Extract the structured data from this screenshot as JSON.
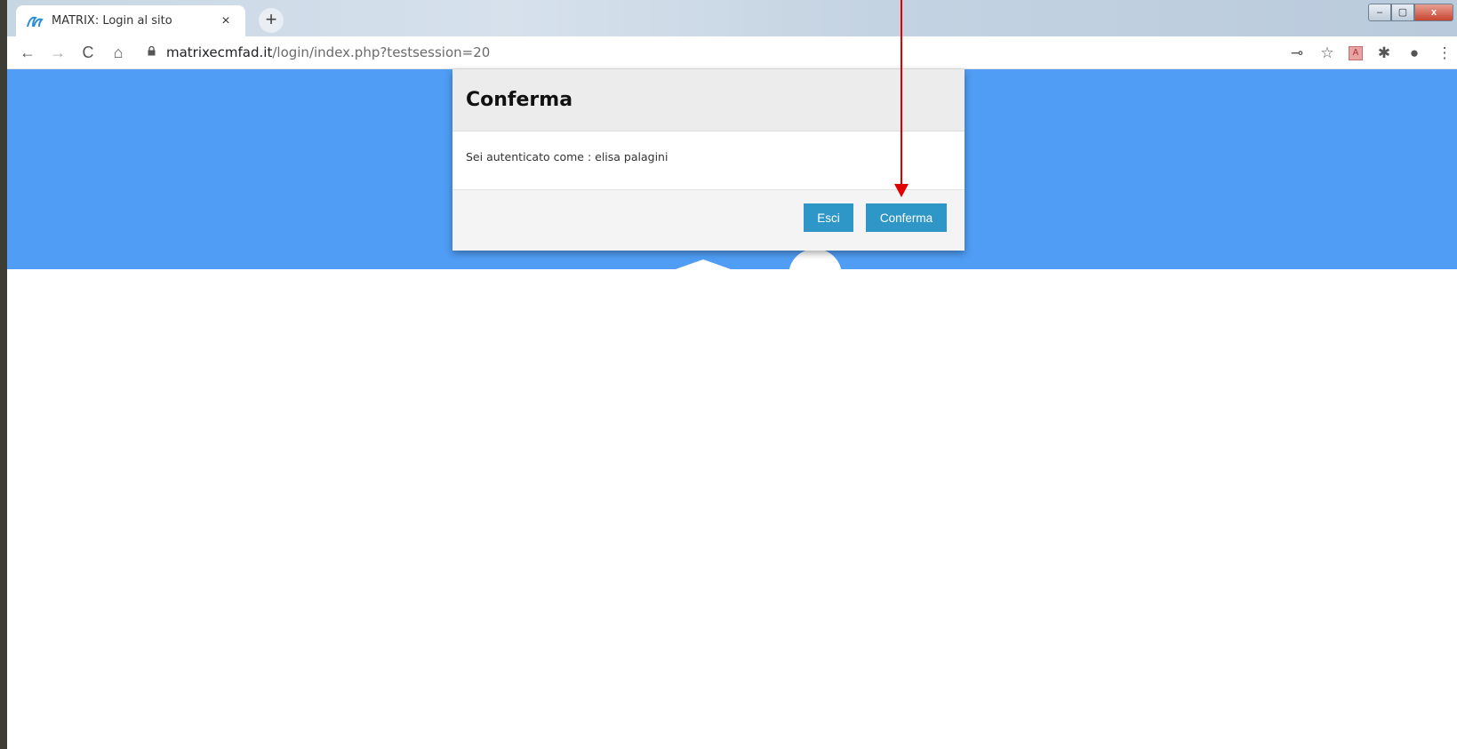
{
  "browser": {
    "tab_title": "MATRIX: Login al sito",
    "tab_close_glyph": "×",
    "new_tab_glyph": "+",
    "url_host": "matrixecmfad.it",
    "url_path": "/login/index.php?testsession=20",
    "nav": {
      "back_glyph": "←",
      "forward_glyph": "→",
      "reload_glyph": "C",
      "home_glyph": "⌂"
    },
    "toolbar_icons": [
      "key-icon",
      "star-icon",
      "pdf-extension-icon",
      "puzzle-extensions-icon",
      "profile-icon",
      "menu-icon"
    ],
    "toolbar_glyphs": {
      "key": "⊸",
      "star": "☆",
      "pdf": "A",
      "puzzle": "✱",
      "profile": "●",
      "menu": "⋮"
    },
    "window_controls": {
      "minimize": "–",
      "maximize": "▢",
      "close": "x"
    }
  },
  "modal": {
    "title": "Conferma",
    "message": "Sei autenticato come : elisa palagini",
    "cancel_label": "Esci",
    "confirm_label": "Conferma"
  },
  "colors": {
    "header_blue": "#4f9df5",
    "button_blue": "#2f96c8",
    "annotation_red": "#e00000"
  }
}
